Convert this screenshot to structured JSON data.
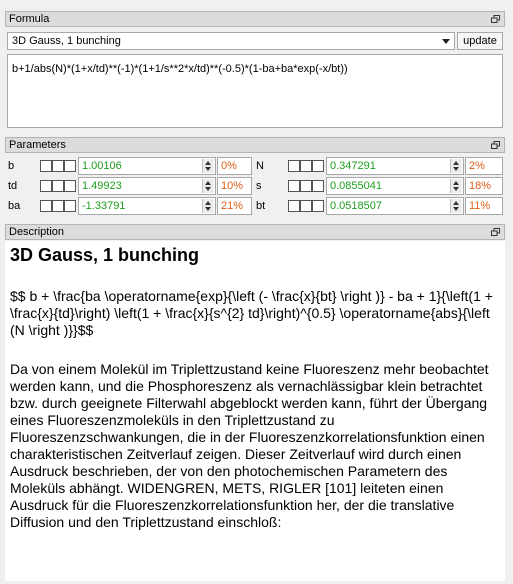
{
  "formula_panel": {
    "title": "Formula",
    "model_select": "3D Gauss, 1 bunching",
    "update_label": "update",
    "formula_text": "b+1/abs(N)*(1+x/td)**(-1)*(1+1/s**2*x/td)**(-0.5)*(1-ba+ba*exp(-x/bt))"
  },
  "parameters_panel": {
    "title": "Parameters",
    "params": [
      {
        "name": "b",
        "value": "1.00106",
        "error": "0%"
      },
      {
        "name": "td",
        "value": "1.49923",
        "error": "10%"
      },
      {
        "name": "ba",
        "value": "-1.33791",
        "error": "21%"
      },
      {
        "name": "N",
        "value": "0.347291",
        "error": "2%"
      },
      {
        "name": "s",
        "value": "0.0855041",
        "error": "18%"
      },
      {
        "name": "bt",
        "value": "0.0518507",
        "error": "11%"
      }
    ]
  },
  "description_panel": {
    "title": "Description",
    "heading": "3D Gauss, 1 bunching",
    "latex": "$$ b + \\frac{ba \\operatorname{exp}{\\left (- \\frac{x}{bt} \\right )} - ba + 1}{\\left(1 + \\frac{x}{td}\\right) \\left(1 + \\frac{x}{s^{2} td}\\right)^{0.5} \\operatorname{abs}{\\left (N \\right )}}$$",
    "body": "Da von einem Molekül im Triplettzustand keine Fluoreszenz mehr beobachtet werden kann, und die Phosphoreszenz als vernachlässigbar klein betrachtet bzw. durch geeignete Filterwahl abgeblockt werden kann, führt der Übergang eines Fluoreszenzmoleküls in den Triplettzustand zu Fluoreszenzschwankungen, die in der Fluoreszenzkorrelationsfunktion einen charakteristischen Zeitverlauf zeigen. Dieser Zeitverlauf wird durch einen Ausdruck beschrieben, der von den photochemischen Parametern des Moleküls abhängt. WIDENGREN, METS, RIGLER [101] leiteten einen Ausdruck für die Fluoreszenzkorrelationsfunktion her, der die translative Diffusion und den Triplettzustand einschloß:"
  },
  "colors": {
    "value_text": "#1e9e1e",
    "error_text": "#e06018",
    "header_bg": "#dcdcdc"
  },
  "icons": {
    "panel_float": "float-window-icon",
    "combo_arrow": "chevron-down-icon"
  }
}
